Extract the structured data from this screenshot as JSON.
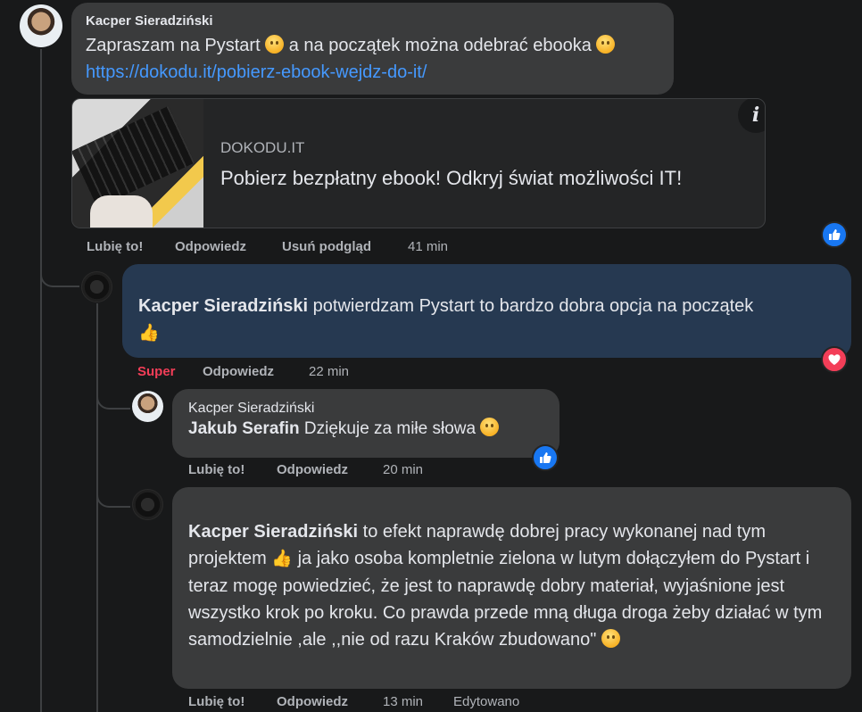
{
  "comment1": {
    "author": "Kacper Sieradziński",
    "text_before_emoji1": "Zapraszam na Pystart",
    "text_middle": "a na początek można odebrać ebooka",
    "link": "https://dokodu.it/pobierz-ebook-wejdz-do-it/",
    "preview": {
      "domain": "DOKODU.IT",
      "title": "Pobierz bezpłatny ebook! Odkryj świat możliwości IT!",
      "info_icon": "info-icon"
    },
    "actions": {
      "like": "Lubię to!",
      "reply": "Odpowiedz",
      "remove_preview": "Usuń podgląd",
      "time": "41 min"
    },
    "reaction": "like-icon"
  },
  "reply1": {
    "mention": "Kacper Sieradziński",
    "text": "potwierdzam Pystart to bardzo dobra opcja na początek",
    "actions": {
      "reaction_label": "Super",
      "reply": "Odpowiedz",
      "time": "22 min"
    },
    "reaction": "love-icon",
    "colors": {
      "bubble": "#263951",
      "super": "#f33e58"
    }
  },
  "reply2": {
    "author": "Kacper Sieradziński",
    "mention": "Jakub Serafin",
    "text": "Dziękuje za miłe słowa",
    "actions": {
      "like": "Lubię to!",
      "reply": "Odpowiedz",
      "time": "20 min"
    },
    "reaction": "like-icon"
  },
  "reply3": {
    "mention": "Kacper Sieradziński",
    "text_part1": "to efekt naprawdę dobrej pracy wykonanej nad tym projektem",
    "text_part2": "ja jako osoba kompletnie zielona w lutym dołączyłem do Pystart i teraz mogę powiedzieć, że jest to naprawdę dobry materiał, wyjaśnione jest wszystko krok po kroku. Co prawda przede mną długa droga żeby działać w tym samodzielnie ,ale ,,nie od razu Kraków zbudowano\"",
    "actions": {
      "like": "Lubię to!",
      "reply": "Odpowiedz",
      "time": "13 min",
      "edited": "Edytowano"
    }
  }
}
